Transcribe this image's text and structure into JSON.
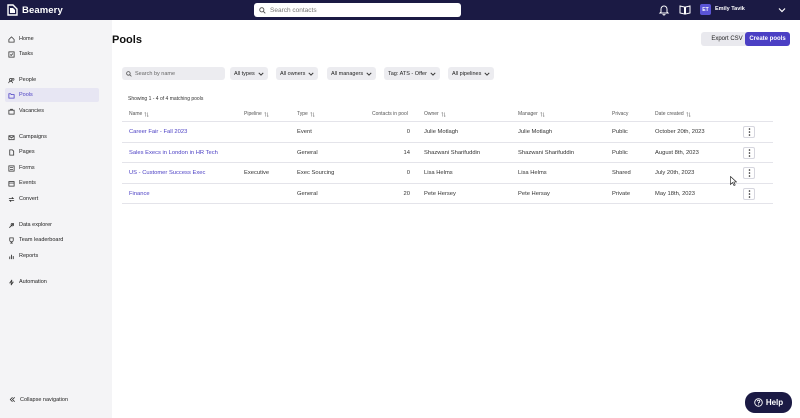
{
  "app": {
    "name": "Beamery"
  },
  "topbar": {
    "search_placeholder": "Search contacts",
    "user": {
      "initials": "ET",
      "name": "Emily Tavik"
    },
    "icons": [
      "bell-icon",
      "book-icon",
      "chevron-down-icon"
    ]
  },
  "sidebar": {
    "items": [
      {
        "label": "Home",
        "icon": "home-icon"
      },
      {
        "label": "Tasks",
        "icon": "checkbox-icon"
      },
      {
        "label": "People",
        "icon": "people-icon"
      },
      {
        "label": "Pools",
        "icon": "folder-icon",
        "active": true
      },
      {
        "label": "Vacancies",
        "icon": "briefcase-icon"
      },
      {
        "label": "Campaigns",
        "icon": "mail-icon"
      },
      {
        "label": "Pages",
        "icon": "page-icon"
      },
      {
        "label": "Forms",
        "icon": "form-icon"
      },
      {
        "label": "Events",
        "icon": "calendar-icon"
      },
      {
        "label": "Convert",
        "icon": "convert-icon"
      },
      {
        "label": "Data explorer",
        "icon": "explorer-icon"
      },
      {
        "label": "Team leaderboard",
        "icon": "trophy-icon"
      },
      {
        "label": "Reports",
        "icon": "chart-icon"
      },
      {
        "label": "Automation",
        "icon": "lightning-icon"
      }
    ],
    "collapse_label": "Collapse navigation"
  },
  "main": {
    "title": "Pools",
    "export_label": "Export CSV",
    "create_label": "Create pools",
    "search_placeholder": "Search by name",
    "filters": {
      "types": "All types",
      "owners": "All owners",
      "managers": "All managers",
      "tag": "Tag: ATS - Offer",
      "pipelines": "All pipelines"
    },
    "showing_text": "Showing 1 - 4 of 4 matching pools",
    "columns": {
      "name": "Name",
      "pipeline": "Pipeline",
      "type": "Type",
      "contacts": "Contacts in pool",
      "owner": "Owner",
      "manager": "Manager",
      "privacy": "Privacy",
      "date": "Date created"
    },
    "rows": [
      {
        "name": "Career Fair - Fall 2023",
        "pipeline": "",
        "type": "Event",
        "contacts": "0",
        "owner": "Julie Motlagh",
        "manager": "Julie Motlagh",
        "privacy": "Public",
        "date": "October 20th, 2023"
      },
      {
        "name": "Sales Execs in London in HR Tech",
        "pipeline": "",
        "type": "General",
        "contacts": "14",
        "owner": "Shazwani Sharifuddin",
        "manager": "Shazwani Sharifuddin",
        "privacy": "Public",
        "date": "August 8th, 2023"
      },
      {
        "name": "US - Customer Success Exec",
        "pipeline": "Executive",
        "type": "Exec Sourcing",
        "contacts": "0",
        "owner": "Lisa Helms",
        "manager": "Lisa Helms",
        "privacy": "Shared",
        "date": "July 20th, 2023"
      },
      {
        "name": "Finance",
        "pipeline": "",
        "type": "General",
        "contacts": "20",
        "owner": "Pete Hersey",
        "manager": "Pete Hersay",
        "privacy": "Private",
        "date": "May 18th, 2023"
      }
    ]
  },
  "help_label": "Help",
  "colors": {
    "brand": "#1b1a44",
    "accent": "#4b3fc4"
  }
}
